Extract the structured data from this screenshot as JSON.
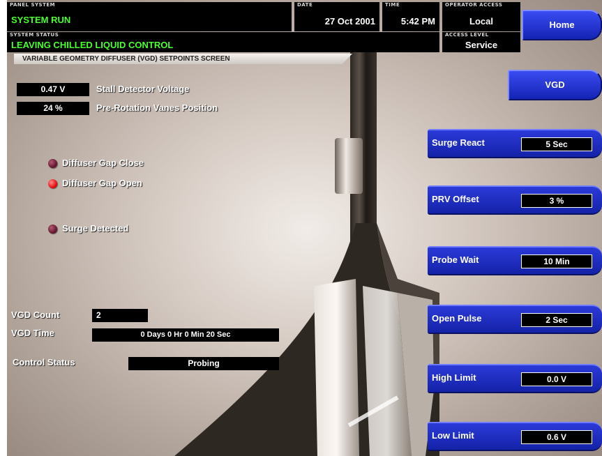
{
  "header": {
    "system_caption": "PANEL SYSTEM",
    "system_value": "SYSTEM RUN",
    "date_caption": "DATE",
    "date_value": "27 Oct 2001",
    "time_caption": "TIME",
    "time_value": "5:42 PM",
    "access_caption": "OPERATOR ACCESS",
    "access_value": "Local",
    "status_caption": "SYSTEM STATUS",
    "status_value": "LEAVING CHILLED LIQUID CONTROL",
    "service_caption": "ACCESS LEVEL",
    "service_value": "Service"
  },
  "subtitle": "VARIABLE GEOMETRY DIFFUSER (VGD) SETPOINTS SCREEN",
  "nav": {
    "home_label": "Home",
    "vgd_label": "VGD"
  },
  "readouts": {
    "stall_voltage_value": "0.47 V",
    "stall_voltage_label": "Stall Detector Voltage",
    "prv_position_value": "24 %",
    "prv_position_label": "Pre-Rotation Vanes Position"
  },
  "indicators": {
    "gap_close": "Diffuser Gap Close",
    "gap_open": "Diffuser Gap Open",
    "surge": "Surge Detected"
  },
  "counters": {
    "count_label": "VGD Count",
    "count_value": "2",
    "time_label": "VGD Time",
    "time_value": "0 Days  0 Hr  0 Min  20 Sec",
    "control_label": "Control Status",
    "control_value": "Probing"
  },
  "setpoints": [
    {
      "label": "Surge React",
      "value": "5 Sec"
    },
    {
      "label": "PRV Offset",
      "value": "3 %"
    },
    {
      "label": "Probe Wait",
      "value": "10 Min"
    },
    {
      "label": "Open Pulse",
      "value": "2 Sec"
    },
    {
      "label": "High Limit",
      "value": "0.0 V"
    },
    {
      "label": "Low Limit",
      "value": "0.6 V"
    }
  ],
  "colors": {
    "header_bg": "#000000",
    "status_green": "#49ff2d",
    "button_blue": "#1f30cc",
    "led_on": "#e00000",
    "led_off": "#6b1834"
  }
}
